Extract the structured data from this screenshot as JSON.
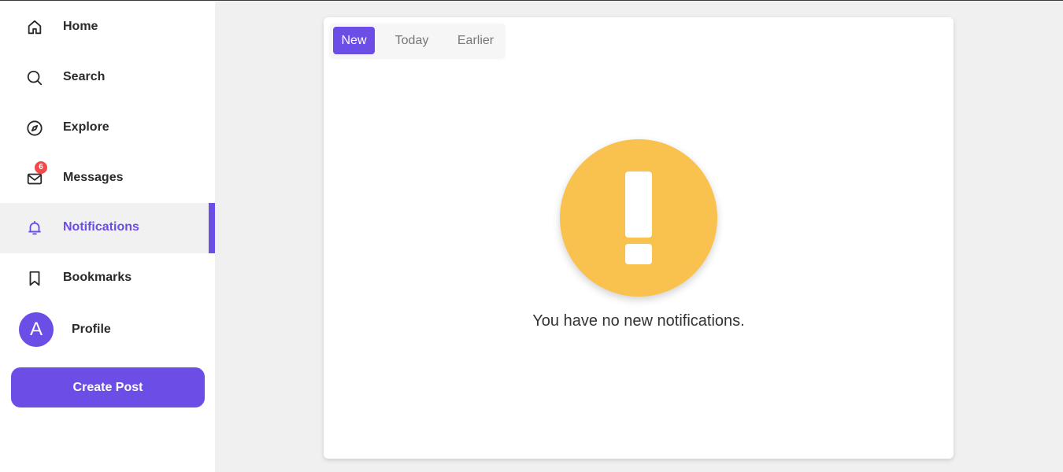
{
  "sidebar": {
    "items": [
      {
        "label": "Home",
        "icon": "home-icon"
      },
      {
        "label": "Search",
        "icon": "search-icon"
      },
      {
        "label": "Explore",
        "icon": "compass-icon"
      },
      {
        "label": "Messages",
        "icon": "mail-icon",
        "badge": "6"
      },
      {
        "label": "Notifications",
        "icon": "bell-icon",
        "active": true
      },
      {
        "label": "Bookmarks",
        "icon": "bookmark-icon"
      }
    ],
    "profile": {
      "avatar_letter": "A",
      "label": "Profile"
    },
    "create_post_label": "Create Post"
  },
  "notifications": {
    "tabs": [
      {
        "label": "New",
        "active": true
      },
      {
        "label": "Today"
      },
      {
        "label": "Earlier"
      }
    ],
    "empty_message": "You have no new notifications.",
    "empty_icon": "exclamation-icon"
  },
  "colors": {
    "accent": "#6c4de6",
    "warning": "#f9c24e",
    "badge": "#f04a4a"
  }
}
